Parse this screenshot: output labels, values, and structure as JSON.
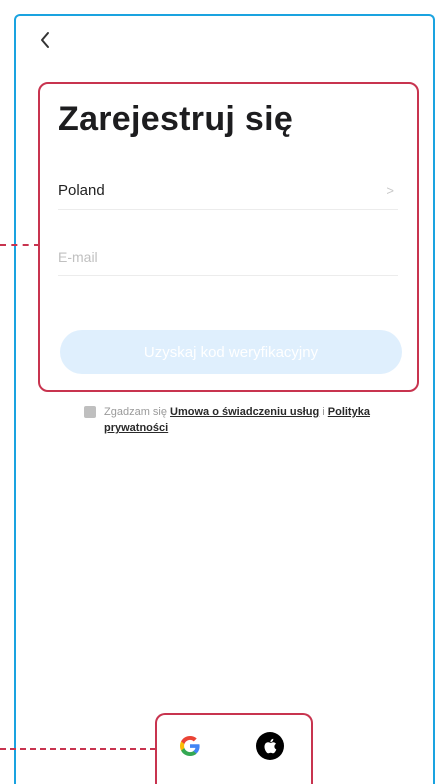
{
  "screen": {
    "title": "Zarejestruj się"
  },
  "form": {
    "country": "Poland",
    "country_chevron": ">",
    "email_placeholder": "E-mail",
    "submit_label": "Uzyskaj kod weryfikacyjny"
  },
  "agreement": {
    "prefix": "Zgadzam się",
    "service_link": "Umowa o świadczeniu usług",
    "separator": "i",
    "privacy_link": "Polityka prywatności"
  },
  "social": {
    "google_letter": "G",
    "icons": [
      "google-icon",
      "apple-icon"
    ]
  },
  "colors": {
    "frame": "#1aa3e0",
    "highlight": "#c8344f",
    "button_disabled": "#dfeffd"
  }
}
